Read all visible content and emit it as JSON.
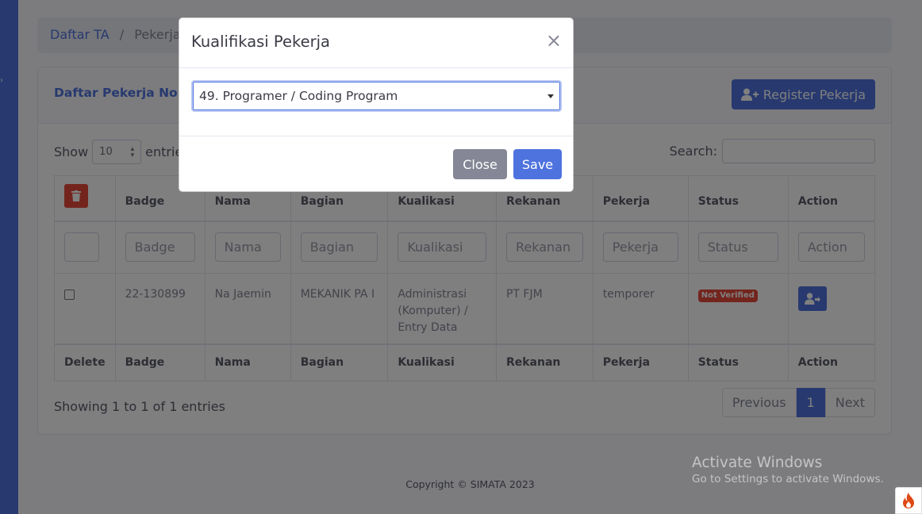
{
  "breadcrumb": {
    "link": "Daftar TA",
    "active": "Pekerja Non-C"
  },
  "card": {
    "title": "Daftar Pekerja Non-C",
    "register_label": "Register Pekerja"
  },
  "table_controls": {
    "show_label": "Show",
    "page_length": "10",
    "entries_label": "entries",
    "search_label": "Search:"
  },
  "table": {
    "headers": [
      "Badge",
      "Nama",
      "Bagian",
      "Kualikasi",
      "Rekanan",
      "Pekerja",
      "Status",
      "Action"
    ],
    "filters": [
      "Badge",
      "Nama",
      "Bagian",
      "Kualikasi",
      "Rekanan",
      "Pekerja",
      "Status",
      "Action"
    ],
    "rows": [
      {
        "badge": "22-130899",
        "nama": "Na Jaemin",
        "bagian": "MEKANIK PA I",
        "kualifikasi": "Administrasi (Komputer) / Entry Data",
        "rekanan": "PT FJM",
        "pekerja": "temporer",
        "status": "Not Verified"
      }
    ],
    "footer": [
      "Delete",
      "Badge",
      "Nama",
      "Bagian",
      "Kualikasi",
      "Rekanan",
      "Pekerja",
      "Status",
      "Action"
    ]
  },
  "info": "Showing 1 to 1 of 1 entries",
  "pagination": {
    "previous": "Previous",
    "page": "1",
    "next": "Next"
  },
  "footer": {
    "copyright": "Copyright © SIMATA 2023"
  },
  "watermark": {
    "line1": "Activate Windows",
    "line2": "Go to Settings to activate Windows."
  },
  "modal": {
    "title": "Kualifikasi Pekerja",
    "close_symbol": "×",
    "selected_option": "49. Programer / Coding Program",
    "close_label": "Close",
    "save_label": "Save"
  },
  "colors": {
    "primary": "#4e73df",
    "danger": "#e74a3b",
    "secondary": "#858796"
  },
  "icons": [
    "trash-icon",
    "user-plus-icon",
    "user-arrow-icon",
    "codeigniter-flame-icon",
    "chevron-right-icon"
  ]
}
